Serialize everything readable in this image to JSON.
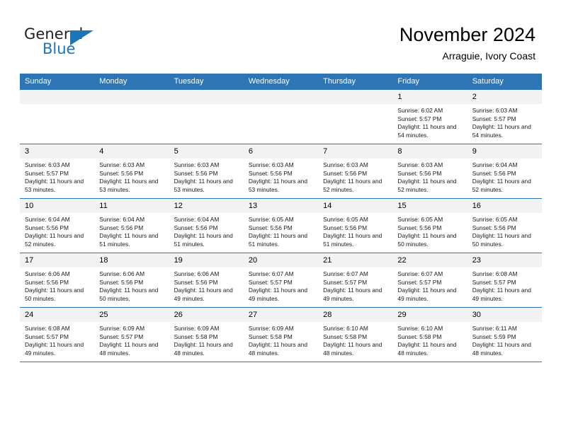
{
  "brand": {
    "name_part1": "General",
    "name_part2": "Blue",
    "triangle_color": "#1b75bb"
  },
  "header": {
    "title": "November 2024",
    "subtitle": "Arraguie, Ivory Coast"
  },
  "theme": {
    "header_blue": "#2e75b6",
    "daynum_gray": "#f2f2f2",
    "text": "#000000"
  },
  "calendar": {
    "weekday_headers": [
      "Sunday",
      "Monday",
      "Tuesday",
      "Wednesday",
      "Thursday",
      "Friday",
      "Saturday"
    ],
    "labels": {
      "sunrise": "Sunrise:",
      "sunset": "Sunset:",
      "daylight": "Daylight:"
    },
    "weeks": [
      [
        {
          "day": "",
          "blank": true
        },
        {
          "day": "",
          "blank": true
        },
        {
          "day": "",
          "blank": true
        },
        {
          "day": "",
          "blank": true
        },
        {
          "day": "",
          "blank": true
        },
        {
          "day": "1",
          "sunrise": "Sunrise: 6:02 AM",
          "sunset": "Sunset: 5:57 PM",
          "daylight": "Daylight: 11 hours and 54 minutes."
        },
        {
          "day": "2",
          "sunrise": "Sunrise: 6:03 AM",
          "sunset": "Sunset: 5:57 PM",
          "daylight": "Daylight: 11 hours and 54 minutes."
        }
      ],
      [
        {
          "day": "3",
          "sunrise": "Sunrise: 6:03 AM",
          "sunset": "Sunset: 5:57 PM",
          "daylight": "Daylight: 11 hours and 53 minutes."
        },
        {
          "day": "4",
          "sunrise": "Sunrise: 6:03 AM",
          "sunset": "Sunset: 5:56 PM",
          "daylight": "Daylight: 11 hours and 53 minutes."
        },
        {
          "day": "5",
          "sunrise": "Sunrise: 6:03 AM",
          "sunset": "Sunset: 5:56 PM",
          "daylight": "Daylight: 11 hours and 53 minutes."
        },
        {
          "day": "6",
          "sunrise": "Sunrise: 6:03 AM",
          "sunset": "Sunset: 5:56 PM",
          "daylight": "Daylight: 11 hours and 53 minutes."
        },
        {
          "day": "7",
          "sunrise": "Sunrise: 6:03 AM",
          "sunset": "Sunset: 5:56 PM",
          "daylight": "Daylight: 11 hours and 52 minutes."
        },
        {
          "day": "8",
          "sunrise": "Sunrise: 6:03 AM",
          "sunset": "Sunset: 5:56 PM",
          "daylight": "Daylight: 11 hours and 52 minutes."
        },
        {
          "day": "9",
          "sunrise": "Sunrise: 6:04 AM",
          "sunset": "Sunset: 5:56 PM",
          "daylight": "Daylight: 11 hours and 52 minutes."
        }
      ],
      [
        {
          "day": "10",
          "sunrise": "Sunrise: 6:04 AM",
          "sunset": "Sunset: 5:56 PM",
          "daylight": "Daylight: 11 hours and 52 minutes."
        },
        {
          "day": "11",
          "sunrise": "Sunrise: 6:04 AM",
          "sunset": "Sunset: 5:56 PM",
          "daylight": "Daylight: 11 hours and 51 minutes."
        },
        {
          "day": "12",
          "sunrise": "Sunrise: 6:04 AM",
          "sunset": "Sunset: 5:56 PM",
          "daylight": "Daylight: 11 hours and 51 minutes."
        },
        {
          "day": "13",
          "sunrise": "Sunrise: 6:05 AM",
          "sunset": "Sunset: 5:56 PM",
          "daylight": "Daylight: 11 hours and 51 minutes."
        },
        {
          "day": "14",
          "sunrise": "Sunrise: 6:05 AM",
          "sunset": "Sunset: 5:56 PM",
          "daylight": "Daylight: 11 hours and 51 minutes."
        },
        {
          "day": "15",
          "sunrise": "Sunrise: 6:05 AM",
          "sunset": "Sunset: 5:56 PM",
          "daylight": "Daylight: 11 hours and 50 minutes."
        },
        {
          "day": "16",
          "sunrise": "Sunrise: 6:05 AM",
          "sunset": "Sunset: 5:56 PM",
          "daylight": "Daylight: 11 hours and 50 minutes."
        }
      ],
      [
        {
          "day": "17",
          "sunrise": "Sunrise: 6:06 AM",
          "sunset": "Sunset: 5:56 PM",
          "daylight": "Daylight: 11 hours and 50 minutes."
        },
        {
          "day": "18",
          "sunrise": "Sunrise: 6:06 AM",
          "sunset": "Sunset: 5:56 PM",
          "daylight": "Daylight: 11 hours and 50 minutes."
        },
        {
          "day": "19",
          "sunrise": "Sunrise: 6:06 AM",
          "sunset": "Sunset: 5:56 PM",
          "daylight": "Daylight: 11 hours and 49 minutes."
        },
        {
          "day": "20",
          "sunrise": "Sunrise: 6:07 AM",
          "sunset": "Sunset: 5:57 PM",
          "daylight": "Daylight: 11 hours and 49 minutes."
        },
        {
          "day": "21",
          "sunrise": "Sunrise: 6:07 AM",
          "sunset": "Sunset: 5:57 PM",
          "daylight": "Daylight: 11 hours and 49 minutes."
        },
        {
          "day": "22",
          "sunrise": "Sunrise: 6:07 AM",
          "sunset": "Sunset: 5:57 PM",
          "daylight": "Daylight: 11 hours and 49 minutes."
        },
        {
          "day": "23",
          "sunrise": "Sunrise: 6:08 AM",
          "sunset": "Sunset: 5:57 PM",
          "daylight": "Daylight: 11 hours and 49 minutes."
        }
      ],
      [
        {
          "day": "24",
          "sunrise": "Sunrise: 6:08 AM",
          "sunset": "Sunset: 5:57 PM",
          "daylight": "Daylight: 11 hours and 49 minutes."
        },
        {
          "day": "25",
          "sunrise": "Sunrise: 6:09 AM",
          "sunset": "Sunset: 5:57 PM",
          "daylight": "Daylight: 11 hours and 48 minutes."
        },
        {
          "day": "26",
          "sunrise": "Sunrise: 6:09 AM",
          "sunset": "Sunset: 5:58 PM",
          "daylight": "Daylight: 11 hours and 48 minutes."
        },
        {
          "day": "27",
          "sunrise": "Sunrise: 6:09 AM",
          "sunset": "Sunset: 5:58 PM",
          "daylight": "Daylight: 11 hours and 48 minutes."
        },
        {
          "day": "28",
          "sunrise": "Sunrise: 6:10 AM",
          "sunset": "Sunset: 5:58 PM",
          "daylight": "Daylight: 11 hours and 48 minutes."
        },
        {
          "day": "29",
          "sunrise": "Sunrise: 6:10 AM",
          "sunset": "Sunset: 5:58 PM",
          "daylight": "Daylight: 11 hours and 48 minutes."
        },
        {
          "day": "30",
          "sunrise": "Sunrise: 6:11 AM",
          "sunset": "Sunset: 5:59 PM",
          "daylight": "Daylight: 11 hours and 48 minutes."
        }
      ]
    ]
  }
}
